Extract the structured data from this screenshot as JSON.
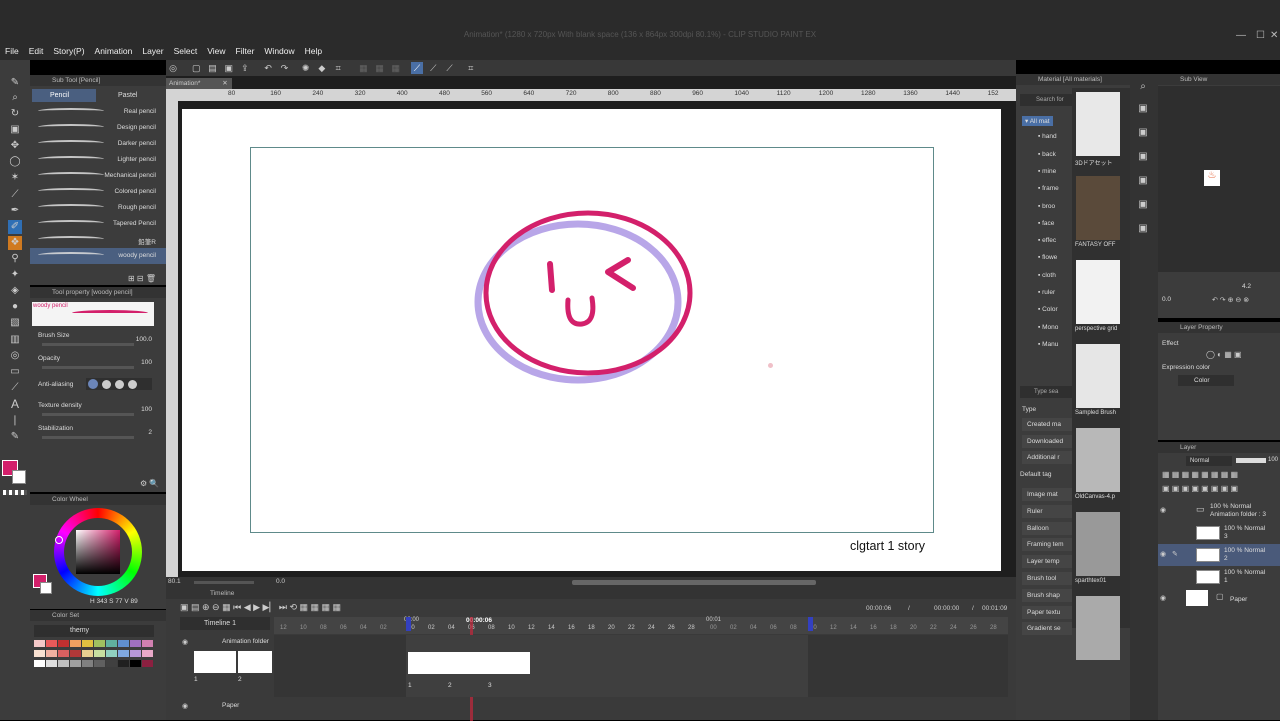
{
  "window": {
    "title": "Animation* (1280 x 720px With blank space (136 x 864px 300dpi 80.1%)  - CLIP STUDIO PAINT EX"
  },
  "menu": [
    "File",
    "Edit",
    "Story(P)",
    "Animation",
    "Layer",
    "Select",
    "View",
    "Filter",
    "Window",
    "Help"
  ],
  "subtool": {
    "header": "Sub Tool [Pencil]",
    "tabs": [
      "Pencil",
      "Pastel"
    ],
    "items": [
      "Real pencil",
      "Design pencil",
      "Darker pencil",
      "Lighter pencil",
      "Mechanical pencil",
      "Colored pencil",
      "Rough pencil",
      "Tapered Pencil",
      "鉛筆R",
      "woody pencil"
    ]
  },
  "toolprop": {
    "header": "Tool property [woody pencil]",
    "preset": "woody pencil",
    "brush_size_label": "Brush Size",
    "brush_size": "100.0",
    "opacity_label": "Opacity",
    "opacity": "100",
    "aa_label": "Anti-aliasing",
    "texture_label": "Texture density",
    "texture": "100",
    "stab_label": "Stabilization",
    "stab": "2"
  },
  "colorwheel": {
    "header": "Color Wheel",
    "h": "343",
    "s": "77",
    "v": "89"
  },
  "colorset": {
    "header": "Color Set",
    "name": "themy"
  },
  "doc": {
    "tab": "Animation*",
    "caption": "clgtart 1 story"
  },
  "ruler": [
    "80",
    "160",
    "240",
    "320",
    "400",
    "480",
    "560",
    "640",
    "720",
    "800",
    "880",
    "960",
    "1040",
    "1120",
    "1200",
    "1280",
    "1360",
    "1440",
    "152"
  ],
  "canvasbar": {
    "zoom": "80.1",
    "angle": "0.0"
  },
  "timeline": {
    "header": "Timeline",
    "selector": "Timeline 1",
    "folder": "Animation folder",
    "paper": "Paper",
    "cur": "00:00:06",
    "start": "00:00:00",
    "end": "00:01:09",
    "marker": "00:00:06",
    "start_mark": "00:00",
    "sec_mark": "00:01",
    "frames_left": [
      "1",
      "2"
    ],
    "frames_right": [
      "1",
      "2",
      "3"
    ],
    "ticks_a": [
      "12",
      "10",
      "08",
      "06",
      "04",
      "02"
    ],
    "ticks_b": [
      "00",
      "02",
      "04",
      "06",
      "08",
      "10",
      "12",
      "14",
      "16",
      "18",
      "20",
      "22",
      "24",
      "26",
      "28"
    ],
    "ticks_c": [
      "00",
      "02",
      "04",
      "06",
      "08",
      "10",
      "12",
      "14",
      "16",
      "18",
      "20",
      "22",
      "24",
      "26",
      "28"
    ]
  },
  "material": {
    "header": "Material [All materials]",
    "search": "Search for",
    "tree": [
      "All mat",
      "hand",
      "back",
      "mine",
      "frame",
      "broo",
      "face",
      "effec",
      "flowe",
      "cloth",
      "ruler",
      "Color",
      "Mono",
      "Manu"
    ],
    "search2": "Type sea",
    "type_label": "Type",
    "buttons": [
      "Created ma",
      "Downloaded",
      "Additional r"
    ],
    "default_tag": "Default tag",
    "tags": [
      "Image mat",
      "Ruler",
      "Balloon",
      "Framing tem",
      "Layer temp",
      "Brush tool",
      "Brush shap",
      "Paper textu",
      "Gradient se"
    ],
    "thumbs": [
      "3Dドアセット",
      "FANTASY OFF",
      "perspective grid",
      "Sampled Brush",
      "OldCanvas-4.p",
      "sparthtex01",
      ""
    ]
  },
  "subview": {
    "header": "Sub View",
    "zoom": "4.2",
    "angle": "0.0"
  },
  "layerprop": {
    "header": "Layer Property",
    "effect": "Effect",
    "expr_label": "Expression color",
    "expr": "Color"
  },
  "layers": {
    "header": "Layer",
    "blend": "Normal",
    "opacity": "100",
    "folder": {
      "line1": "100 % Normal",
      "line2": "Animation folder : 3"
    },
    "items": [
      {
        "line1": "100 % Normal",
        "line2": "3"
      },
      {
        "line1": "100 % Normal",
        "line2": "2"
      },
      {
        "line1": "100 % Normal",
        "line2": "1"
      }
    ],
    "paper": "Paper"
  },
  "colors": {
    "primary": "#d3206b",
    "secondary": "#ffffff",
    "accent": "#4a90d9"
  }
}
